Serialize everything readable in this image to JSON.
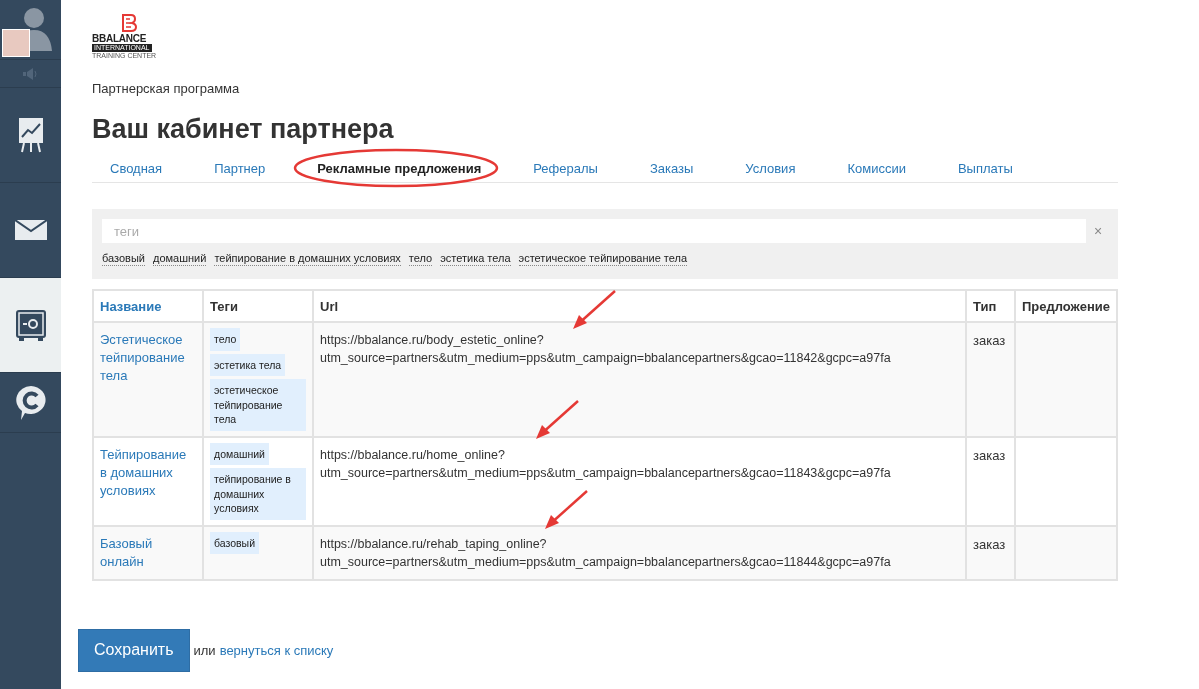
{
  "sidebar": {
    "items": [
      {
        "kind": "avatar",
        "selected": false
      },
      {
        "kind": "sound",
        "selected": false
      },
      {
        "kind": "chart",
        "selected": false
      },
      {
        "kind": "mail",
        "selected": false
      },
      {
        "kind": "safe",
        "selected": true
      },
      {
        "kind": "chat",
        "selected": false
      }
    ]
  },
  "logo": {
    "name": "BBALANCE",
    "line1": "INTERNATIONAL",
    "line2": "TRAINING CENTER"
  },
  "breadcrumb": "Партнерская программа",
  "title": "Ваш кабинет партнера",
  "tabs": [
    {
      "label": "Сводная",
      "selected": false
    },
    {
      "label": "Партнер",
      "selected": false
    },
    {
      "label": "Рекламные предложения",
      "selected": true
    },
    {
      "label": "Рефералы",
      "selected": false
    },
    {
      "label": "Заказы",
      "selected": false
    },
    {
      "label": "Условия",
      "selected": false
    },
    {
      "label": "Комиссии",
      "selected": false
    },
    {
      "label": "Выплаты",
      "selected": false
    }
  ],
  "filter": {
    "placeholder": "теги",
    "clear": "×",
    "tags": [
      "базовый",
      "домашний",
      "тейпирование в домашних условиях",
      "тело",
      "эстетика тела",
      "эстетическое тейпирование тела"
    ]
  },
  "table": {
    "columns": [
      "Название",
      "Теги",
      "Url",
      "Тип",
      "Предложение"
    ],
    "rows": [
      {
        "name": "Эстетическое тейпирование тела",
        "tags": [
          "тело",
          "эстетика тела",
          "эстетическое тейпирование тела"
        ],
        "url_line1": "https://bbalance.ru/body_estetic_online?",
        "url_line2": "utm_source=partners&utm_medium=pps&utm_campaign=bbalancepartners&gcao=11842&gcpc=a97fa",
        "type": "заказ"
      },
      {
        "name": "Тейпирование в домашних условиях",
        "tags": [
          "домашний",
          "тейпирование в домашних условиях"
        ],
        "url_line1": "https://bbalance.ru/home_online?",
        "url_line2": "utm_source=partners&utm_medium=pps&utm_campaign=bbalancepartners&gcao=11843&gcpc=a97fa",
        "type": "заказ"
      },
      {
        "name": "Базовый онлайн",
        "tags": [
          "базовый"
        ],
        "url_line1": "https://bbalance.ru/rehab_taping_online?",
        "url_line2": "utm_source=partners&utm_medium=pps&utm_campaign=bbalancepartners&gcao=11844&gcpc=a97fa",
        "type": "заказ"
      }
    ]
  },
  "save_button": "Сохранить",
  "or_text": "или",
  "back_link": "вернуться к списку"
}
